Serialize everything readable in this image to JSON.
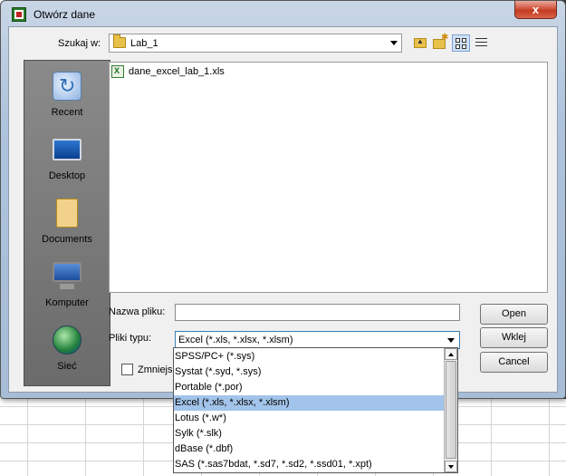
{
  "window": {
    "title": "Otwórz dane",
    "close_label": "x"
  },
  "lookin": {
    "label": "Szukaj w:",
    "value": "Lab_1"
  },
  "toolbar": {
    "icons": [
      "up-folder-icon",
      "new-folder-icon",
      "list-view-icon",
      "details-view-icon"
    ]
  },
  "places": [
    {
      "label": "Recent",
      "icon": "recent-icon"
    },
    {
      "label": "Desktop",
      "icon": "desktop-icon"
    },
    {
      "label": "Documents",
      "icon": "documents-icon"
    },
    {
      "label": "Komputer",
      "icon": "computer-icon"
    },
    {
      "label": "Sieć",
      "icon": "network-icon"
    }
  ],
  "files": [
    {
      "name": "dane_excel_lab_1.xls",
      "icon": "excel-file-icon"
    }
  ],
  "filename": {
    "label": "Nazwa pliku:",
    "value": ""
  },
  "filetype": {
    "label": "Pliki typu:",
    "value": "Excel (*.xls, *.xlsx, *.xlsm)",
    "options": [
      "SPSS/PC+ (*.sys)",
      "Systat (*.syd, *.sys)",
      "Portable (*.por)",
      "Excel (*.xls, *.xlsx, *.xlsm)",
      "Lotus (*.w*)",
      "Sylk (*.slk)",
      "dBase (*.dbf)",
      "SAS (*.sas7bdat, *.sd7, *.sd2, *.ssd01, *.xpt)"
    ],
    "selected_index": 3
  },
  "buttons": {
    "open": "Open",
    "paste": "Wklej",
    "cancel": "Cancel"
  },
  "shrink": {
    "label": "Zmniejsz"
  },
  "colors": {
    "selection": "#a3c4ea",
    "close_button": "#c33a20"
  }
}
